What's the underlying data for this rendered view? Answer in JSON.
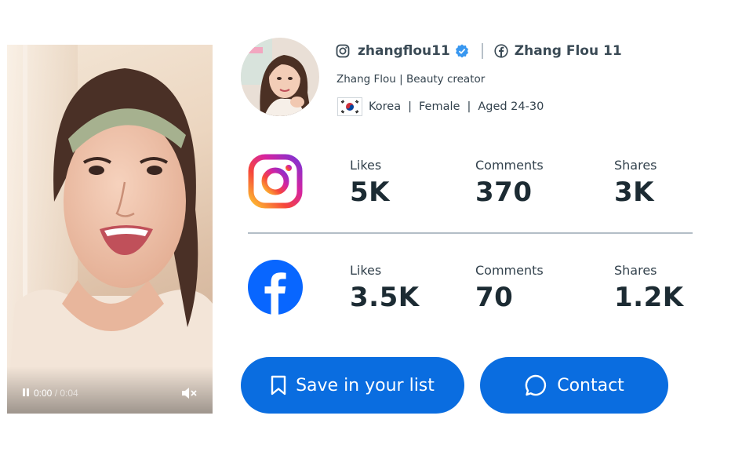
{
  "video": {
    "time_current": "0:00",
    "time_separator": " / ",
    "time_duration": "0:04"
  },
  "profile": {
    "instagram_handle": "zhangflou11",
    "facebook_name": "Zhang Flou 11",
    "bio_name": "Zhang Flou",
    "bio_separator": "|",
    "bio_category": "Beauty creator",
    "country": "Korea",
    "gender": "Female",
    "age": "Aged 24-30",
    "meta_separator": "|"
  },
  "instagram_stats": {
    "likes_label": "Likes",
    "likes_value": "5K",
    "comments_label": "Comments",
    "comments_value": "370",
    "shares_label": "Shares",
    "shares_value": "3K"
  },
  "facebook_stats": {
    "likes_label": "Likes",
    "likes_value": "3.5K",
    "comments_label": "Comments",
    "comments_value": "70",
    "shares_label": "Shares",
    "shares_value": "1.2K"
  },
  "actions": {
    "save_label": "Save in your list",
    "contact_label": "Contact"
  },
  "icons": {
    "instagram": "instagram-icon",
    "facebook": "facebook-icon",
    "verified": "verified-badge-icon",
    "bookmark": "bookmark-icon",
    "chat": "chat-bubble-icon",
    "pause": "pause-icon",
    "mute": "mute-icon",
    "flag": "south-korea-flag-icon"
  },
  "colors": {
    "brand_blue": "#0a6de0",
    "facebook_blue": "#0866ff",
    "text_dark": "#1c2b33",
    "divider": "#b3bec7"
  }
}
